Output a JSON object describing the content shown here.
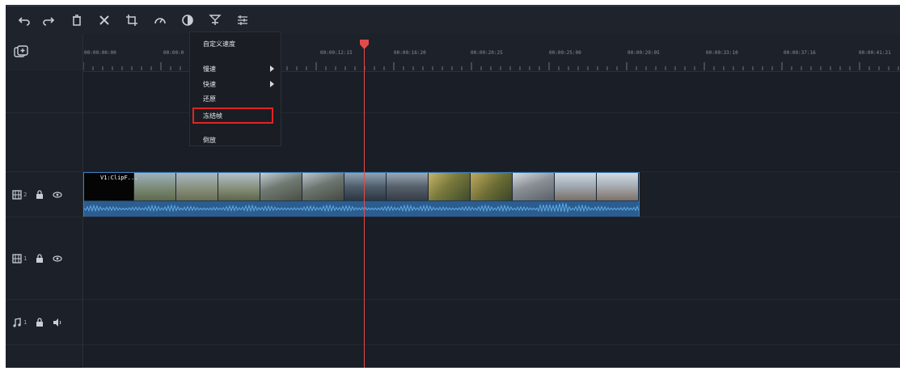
{
  "toolbar": {
    "icons": [
      "undo-icon",
      "redo-icon",
      "delete-icon",
      "cut-icon",
      "crop-icon",
      "speed-icon",
      "color-icon",
      "marker-icon",
      "adjust-icon"
    ]
  },
  "timeline": {
    "timecodes": [
      "00:00:00:00",
      "00:00:0",
      "00:00:12:15",
      "00:00:16:20",
      "00:00:20:25",
      "00:00:25:00",
      "00:00:29:05",
      "00:00:33:10",
      "00:00:37:16",
      "00:00:41:21"
    ]
  },
  "tracks": [
    {
      "number": "2",
      "type": "video"
    },
    {
      "number": "1",
      "type": "video"
    },
    {
      "number": "1",
      "type": "audio"
    }
  ],
  "clip": {
    "title": "V1:ClipF..."
  },
  "context_menu": {
    "custom_speed": "自定义速度",
    "slow": "慢速",
    "fast": "快速",
    "reset": "还原",
    "freeze_frame": "冻结帧",
    "reverse": "倒放"
  },
  "colors": {
    "playhead": "#e14b4b",
    "highlight": "#e02424",
    "clip_border": "#3d7fb9",
    "audio_wave": "#5fa8e8"
  }
}
